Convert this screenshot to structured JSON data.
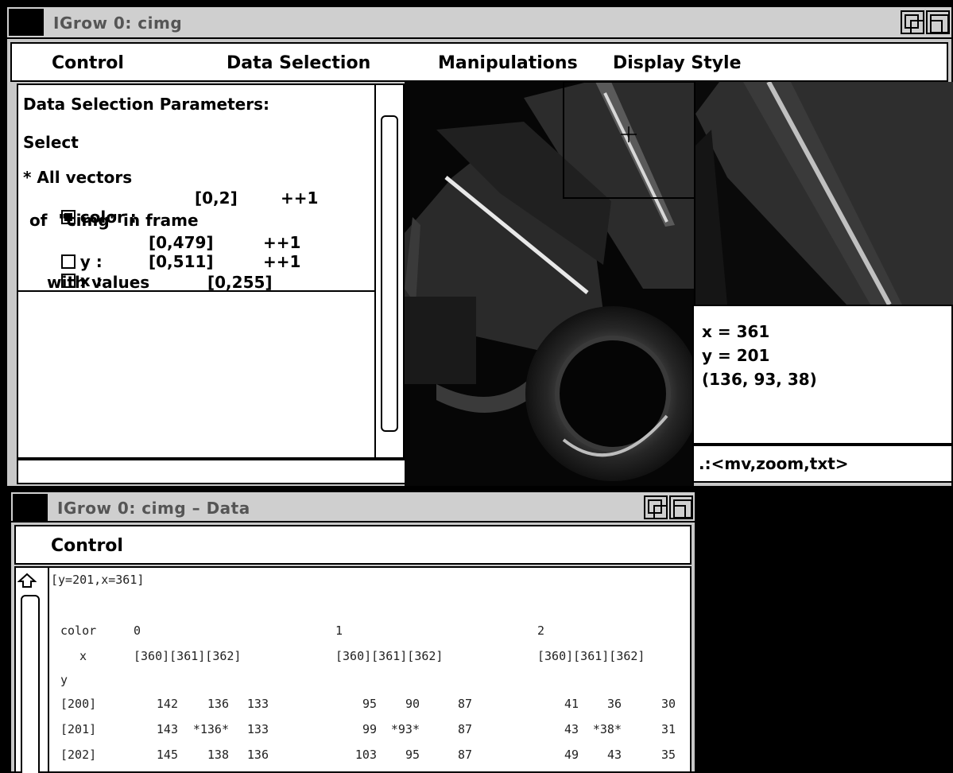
{
  "main_window": {
    "title": "IGrow 0: cimg",
    "menu": [
      "Control",
      "Data Selection",
      "Manipulations",
      "Display Style"
    ]
  },
  "params": {
    "heading": "Data Selection Parameters:",
    "select_label": "Select",
    "all_vectors": "* All vectors",
    "color_label": "color :",
    "color_range": "[0,2]",
    "color_step": "++1",
    "color_checked": true,
    "of_frame": "of  \"cimg\" in frame",
    "y_label": "y :",
    "y_range": "[0,479]",
    "y_step": "++1",
    "y_checked": false,
    "x_label": "x :",
    "x_range": "[0,511]",
    "x_step": "++1",
    "x_checked": false,
    "with_values": "with values",
    "values_range": "[0,255]"
  },
  "info": {
    "x_line": "x = 361",
    "y_line": "y = 201",
    "rgb_line": "(136, 93, 38)"
  },
  "command": ".:<mv,zoom,txt>",
  "data_window": {
    "title": "IGrow 0: cimg – Data",
    "menu": [
      "Control"
    ],
    "header": "[y=201,x=361]",
    "color_label": "color",
    "color_groups": [
      "0",
      "1",
      "2"
    ],
    "x_label": "x",
    "x_cols": [
      "[360][361][362]",
      "[360][361][362]",
      "[360][361][362]"
    ],
    "y_label": "y",
    "rows": [
      {
        "y": "[200]",
        "vals": [
          "142",
          "136",
          "133",
          "95",
          "90",
          "87",
          "41",
          "36",
          "30"
        ]
      },
      {
        "y": "[201]",
        "vals": [
          "143",
          "*136*",
          "133",
          "99",
          "*93*",
          "87",
          "43",
          "*38*",
          "31"
        ]
      },
      {
        "y": "[202]",
        "vals": [
          "145",
          "138",
          "136",
          "103",
          "95",
          "87",
          "49",
          "43",
          "35"
        ]
      }
    ]
  },
  "icons": {
    "scroll_up": "up-arrow-icon",
    "scroll_down": "down-arrow-icon",
    "crosshair": "crosshair-icon",
    "window_resize": "resize-icon",
    "window_iconify": "iconify-icon"
  }
}
